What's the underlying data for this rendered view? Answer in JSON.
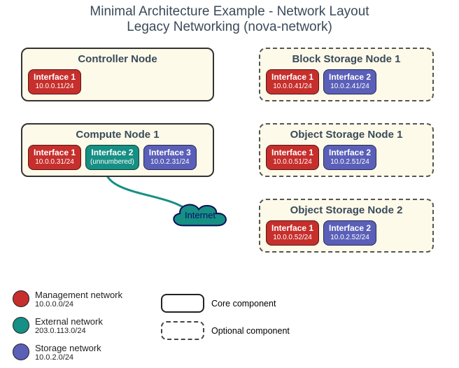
{
  "title": {
    "line1": "Minimal Architecture Example - Network Layout",
    "line2": "Legacy Networking (nova-network)"
  },
  "nodes": {
    "controller": {
      "title": "Controller Node",
      "ifaces": [
        {
          "name": "Interface 1",
          "addr": "10.0.0.11/24",
          "net": "mgmt"
        }
      ]
    },
    "compute1": {
      "title": "Compute Node 1",
      "ifaces": [
        {
          "name": "Interface 1",
          "addr": "10.0.0.31/24",
          "net": "mgmt"
        },
        {
          "name": "Interface 2",
          "addr": "(unnumbered)",
          "net": "ext"
        },
        {
          "name": "Interface 3",
          "addr": "10.0.2.31/24",
          "net": "stor"
        }
      ]
    },
    "block1": {
      "title": "Block Storage Node 1",
      "ifaces": [
        {
          "name": "Interface 1",
          "addr": "10.0.0.41/24",
          "net": "mgmt"
        },
        {
          "name": "Interface 2",
          "addr": "10.0.2.41/24",
          "net": "stor"
        }
      ]
    },
    "object1": {
      "title": "Object Storage Node 1",
      "ifaces": [
        {
          "name": "Interface 1",
          "addr": "10.0.0.51/24",
          "net": "mgmt"
        },
        {
          "name": "Interface 2",
          "addr": "10.0.2.51/24",
          "net": "stor"
        }
      ]
    },
    "object2": {
      "title": "Object Storage Node 2",
      "ifaces": [
        {
          "name": "Interface 1",
          "addr": "10.0.0.52/24",
          "net": "mgmt"
        },
        {
          "name": "Interface 2",
          "addr": "10.0.2.52/24",
          "net": "stor"
        }
      ]
    }
  },
  "internet": {
    "label": "Internet"
  },
  "legend_networks": [
    {
      "name": "Management network",
      "addr": "10.0.0.0/24",
      "color": "#c62f2c"
    },
    {
      "name": "External network",
      "addr": "203.0.113.0/24",
      "color": "#168f84"
    },
    {
      "name": "Storage network",
      "addr": "10.0.2.0/24",
      "color": "#5a5fb8"
    }
  ],
  "legend_components": {
    "core": "Core component",
    "optional": "Optional component"
  }
}
